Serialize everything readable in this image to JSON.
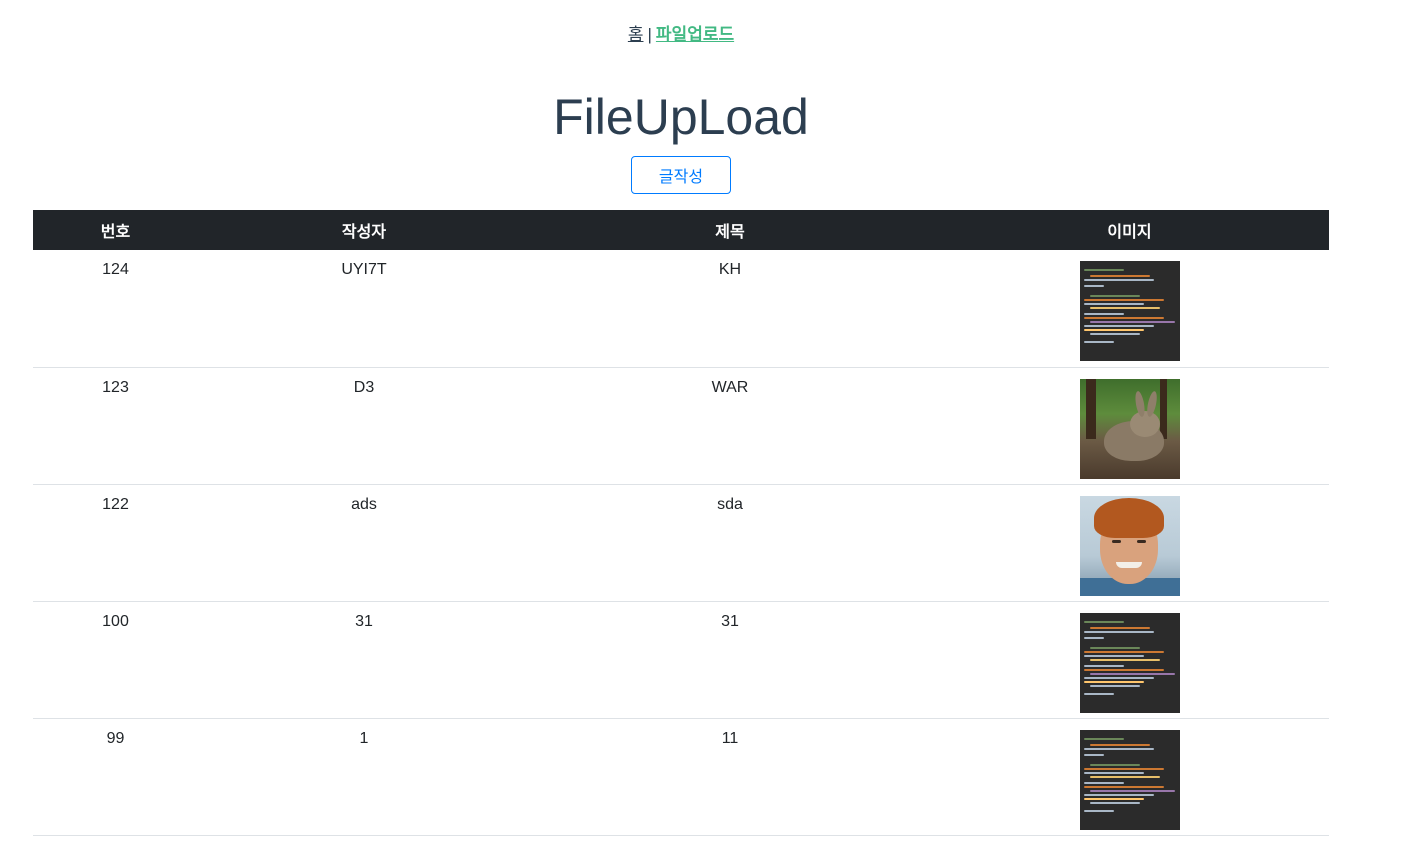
{
  "nav": {
    "home_label": "홈",
    "separator": "|",
    "upload_label": "파일업로드"
  },
  "page": {
    "title": "FileUpLoad",
    "write_button_label": "글작성"
  },
  "table": {
    "headers": [
      "번호",
      "작성자",
      "제목",
      "이미지"
    ],
    "rows": [
      {
        "no": "124",
        "author": "UYI7T",
        "title": "KH",
        "image": "code-screenshot"
      },
      {
        "no": "123",
        "author": "D3",
        "title": "WAR",
        "image": "rabbit-photo"
      },
      {
        "no": "122",
        "author": "ads",
        "title": "sda",
        "image": "man-portrait"
      },
      {
        "no": "100",
        "author": "31",
        "title": "31",
        "image": "code-screenshot"
      },
      {
        "no": "99",
        "author": "1",
        "title": "11",
        "image": "code-screenshot"
      }
    ]
  },
  "colors": {
    "header_bg": "#212529",
    "link_active": "#42b983",
    "button_border": "#007bff",
    "row_divider": "#dee2e6"
  }
}
